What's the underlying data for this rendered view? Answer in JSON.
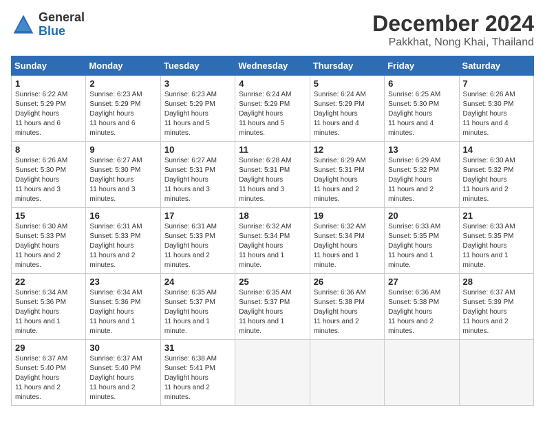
{
  "header": {
    "logo_general": "General",
    "logo_blue": "Blue",
    "month_year": "December 2024",
    "location": "Pakkhat, Nong Khai, Thailand"
  },
  "days_of_week": [
    "Sunday",
    "Monday",
    "Tuesday",
    "Wednesday",
    "Thursday",
    "Friday",
    "Saturday"
  ],
  "weeks": [
    [
      {
        "day": "1",
        "sunrise": "6:22 AM",
        "sunset": "5:29 PM",
        "daylight": "11 hours and 6 minutes."
      },
      {
        "day": "2",
        "sunrise": "6:23 AM",
        "sunset": "5:29 PM",
        "daylight": "11 hours and 6 minutes."
      },
      {
        "day": "3",
        "sunrise": "6:23 AM",
        "sunset": "5:29 PM",
        "daylight": "11 hours and 5 minutes."
      },
      {
        "day": "4",
        "sunrise": "6:24 AM",
        "sunset": "5:29 PM",
        "daylight": "11 hours and 5 minutes."
      },
      {
        "day": "5",
        "sunrise": "6:24 AM",
        "sunset": "5:29 PM",
        "daylight": "11 hours and 4 minutes."
      },
      {
        "day": "6",
        "sunrise": "6:25 AM",
        "sunset": "5:30 PM",
        "daylight": "11 hours and 4 minutes."
      },
      {
        "day": "7",
        "sunrise": "6:26 AM",
        "sunset": "5:30 PM",
        "daylight": "11 hours and 4 minutes."
      }
    ],
    [
      {
        "day": "8",
        "sunrise": "6:26 AM",
        "sunset": "5:30 PM",
        "daylight": "11 hours and 3 minutes."
      },
      {
        "day": "9",
        "sunrise": "6:27 AM",
        "sunset": "5:30 PM",
        "daylight": "11 hours and 3 minutes."
      },
      {
        "day": "10",
        "sunrise": "6:27 AM",
        "sunset": "5:31 PM",
        "daylight": "11 hours and 3 minutes."
      },
      {
        "day": "11",
        "sunrise": "6:28 AM",
        "sunset": "5:31 PM",
        "daylight": "11 hours and 3 minutes."
      },
      {
        "day": "12",
        "sunrise": "6:29 AM",
        "sunset": "5:31 PM",
        "daylight": "11 hours and 2 minutes."
      },
      {
        "day": "13",
        "sunrise": "6:29 AM",
        "sunset": "5:32 PM",
        "daylight": "11 hours and 2 minutes."
      },
      {
        "day": "14",
        "sunrise": "6:30 AM",
        "sunset": "5:32 PM",
        "daylight": "11 hours and 2 minutes."
      }
    ],
    [
      {
        "day": "15",
        "sunrise": "6:30 AM",
        "sunset": "5:33 PM",
        "daylight": "11 hours and 2 minutes."
      },
      {
        "day": "16",
        "sunrise": "6:31 AM",
        "sunset": "5:33 PM",
        "daylight": "11 hours and 2 minutes."
      },
      {
        "day": "17",
        "sunrise": "6:31 AM",
        "sunset": "5:33 PM",
        "daylight": "11 hours and 2 minutes."
      },
      {
        "day": "18",
        "sunrise": "6:32 AM",
        "sunset": "5:34 PM",
        "daylight": "11 hours and 1 minute."
      },
      {
        "day": "19",
        "sunrise": "6:32 AM",
        "sunset": "5:34 PM",
        "daylight": "11 hours and 1 minute."
      },
      {
        "day": "20",
        "sunrise": "6:33 AM",
        "sunset": "5:35 PM",
        "daylight": "11 hours and 1 minute."
      },
      {
        "day": "21",
        "sunrise": "6:33 AM",
        "sunset": "5:35 PM",
        "daylight": "11 hours and 1 minute."
      }
    ],
    [
      {
        "day": "22",
        "sunrise": "6:34 AM",
        "sunset": "5:36 PM",
        "daylight": "11 hours and 1 minute."
      },
      {
        "day": "23",
        "sunrise": "6:34 AM",
        "sunset": "5:36 PM",
        "daylight": "11 hours and 1 minute."
      },
      {
        "day": "24",
        "sunrise": "6:35 AM",
        "sunset": "5:37 PM",
        "daylight": "11 hours and 1 minute."
      },
      {
        "day": "25",
        "sunrise": "6:35 AM",
        "sunset": "5:37 PM",
        "daylight": "11 hours and 1 minute."
      },
      {
        "day": "26",
        "sunrise": "6:36 AM",
        "sunset": "5:38 PM",
        "daylight": "11 hours and 2 minutes."
      },
      {
        "day": "27",
        "sunrise": "6:36 AM",
        "sunset": "5:38 PM",
        "daylight": "11 hours and 2 minutes."
      },
      {
        "day": "28",
        "sunrise": "6:37 AM",
        "sunset": "5:39 PM",
        "daylight": "11 hours and 2 minutes."
      }
    ],
    [
      {
        "day": "29",
        "sunrise": "6:37 AM",
        "sunset": "5:40 PM",
        "daylight": "11 hours and 2 minutes."
      },
      {
        "day": "30",
        "sunrise": "6:37 AM",
        "sunset": "5:40 PM",
        "daylight": "11 hours and 2 minutes."
      },
      {
        "day": "31",
        "sunrise": "6:38 AM",
        "sunset": "5:41 PM",
        "daylight": "11 hours and 2 minutes."
      },
      null,
      null,
      null,
      null
    ]
  ]
}
